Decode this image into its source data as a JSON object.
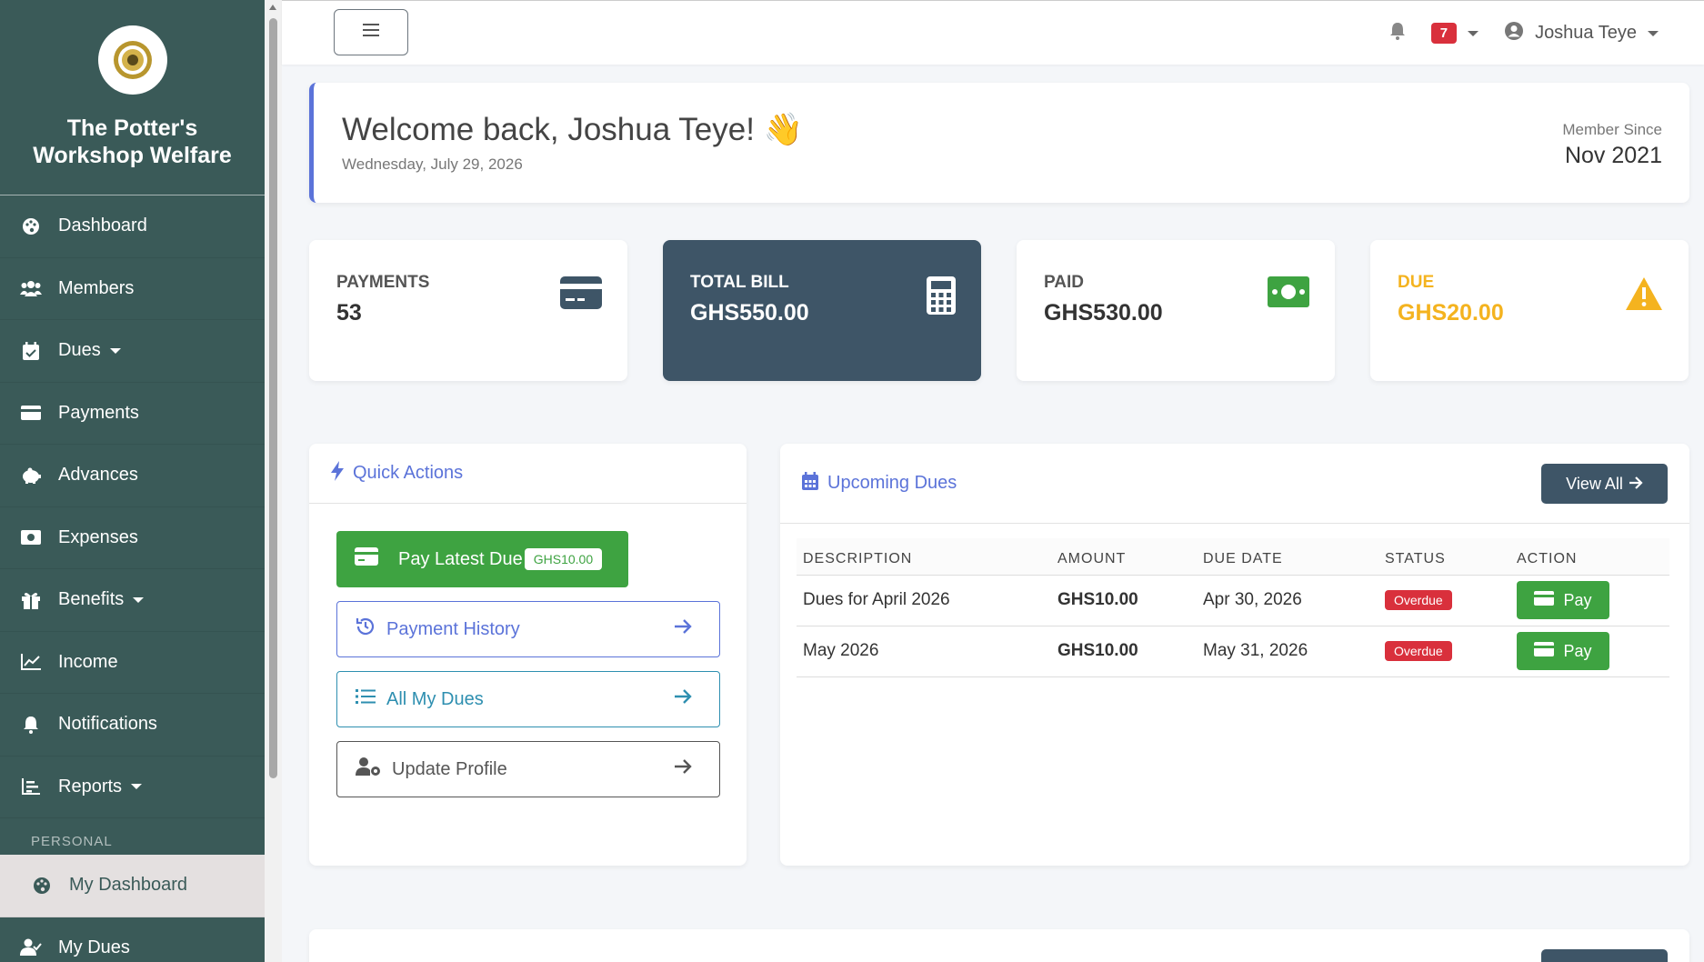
{
  "sidebar": {
    "brand_name": "The Potter's Workshop Welfare",
    "items": [
      {
        "label": "Dashboard",
        "icon": "palette-icon"
      },
      {
        "label": "Members",
        "icon": "users-icon"
      },
      {
        "label": "Dues",
        "icon": "calendar-check-icon",
        "has_caret": true
      },
      {
        "label": "Payments",
        "icon": "credit-card-icon"
      },
      {
        "label": "Advances",
        "icon": "piggy-bank-icon"
      },
      {
        "label": "Expenses",
        "icon": "money-bill-icon"
      },
      {
        "label": "Benefits",
        "icon": "gift-icon",
        "has_caret": true
      },
      {
        "label": "Income",
        "icon": "line-chart-icon"
      },
      {
        "label": "Notifications",
        "icon": "bell-icon"
      },
      {
        "label": "Reports",
        "icon": "bar-chart-icon",
        "has_caret": true
      }
    ],
    "section_personal": "PERSONAL",
    "personal_items": [
      {
        "label": "My Dashboard",
        "icon": "palette-icon",
        "active": true
      },
      {
        "label": "My Dues",
        "icon": "user-check-icon"
      }
    ]
  },
  "topbar": {
    "notification_count": "7",
    "user_name": "Joshua Teye"
  },
  "welcome": {
    "title": "Welcome back, Joshua Teye! 👋",
    "date": "Wednesday, July 29, 2026",
    "member_since_label": "Member Since",
    "member_since_value": "Nov 2021"
  },
  "stats": {
    "payments_label": "PAYMENTS",
    "payments_value": "53",
    "total_bill_label": "TOTAL BILL",
    "total_bill_value": "GHS550.00",
    "paid_label": "PAID",
    "paid_value": "GHS530.00",
    "due_label": "DUE",
    "due_value": "GHS20.00"
  },
  "quick_actions": {
    "title": "Quick Actions",
    "pay_latest_label": "Pay Latest Due",
    "pay_latest_amount": "GHS10.00",
    "payment_history": "Payment History",
    "all_my_dues": "All My Dues",
    "update_profile": "Update Profile"
  },
  "upcoming_dues": {
    "title": "Upcoming Dues",
    "view_all": "View All",
    "columns": [
      "DESCRIPTION",
      "AMOUNT",
      "DUE DATE",
      "STATUS",
      "ACTION"
    ],
    "rows": [
      {
        "description": "Dues for April 2026",
        "amount": "GHS10.00",
        "due_date": "Apr 30, 2026",
        "status": "Overdue",
        "action": "Pay"
      },
      {
        "description": "May 2026",
        "amount": "GHS10.00",
        "due_date": "May 31, 2026",
        "status": "Overdue",
        "action": "Pay"
      }
    ]
  },
  "colors": {
    "sidebar_bg": "#3a5a58",
    "accent_blue": "#5b73d9",
    "dark_card": "#3e5567",
    "green": "#3ea341",
    "red": "#d9303c",
    "warning": "#f4b31f"
  }
}
